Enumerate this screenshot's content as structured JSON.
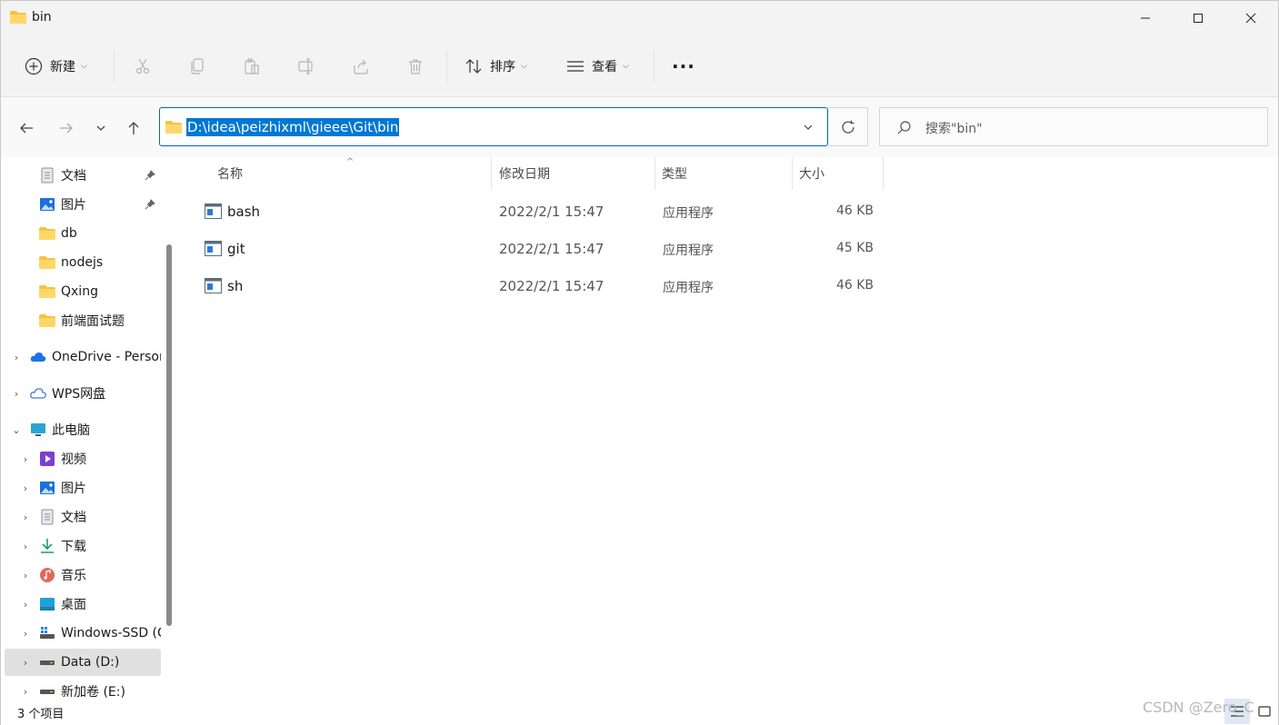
{
  "window": {
    "title": "bin"
  },
  "toolbar": {
    "new_label": "新建",
    "sort_label": "排序",
    "view_label": "查看",
    "more_label": "···"
  },
  "address": {
    "path": "D:\\idea\\peizhixml\\gieee\\Git\\bin",
    "search_placeholder": "搜索\"bin\""
  },
  "sidebar": {
    "quick_items": [
      {
        "label": "文档",
        "icon": "document-icon",
        "pinned": true
      },
      {
        "label": "图片",
        "icon": "pictures-icon",
        "pinned": true
      },
      {
        "label": "db",
        "icon": "folder-icon"
      },
      {
        "label": "nodejs",
        "icon": "folder-icon"
      },
      {
        "label": "Qxing",
        "icon": "folder-icon"
      },
      {
        "label": "前端面试题",
        "icon": "folder-icon"
      }
    ],
    "onedrive": "OneDrive - Personal",
    "wps": "WPS网盘",
    "thispc": "此电脑",
    "pc_items": [
      {
        "label": "视频",
        "icon": "videos-icon"
      },
      {
        "label": "图片",
        "icon": "pictures-icon"
      },
      {
        "label": "文档",
        "icon": "document-icon"
      },
      {
        "label": "下载",
        "icon": "download-icon"
      },
      {
        "label": "音乐",
        "icon": "music-icon"
      },
      {
        "label": "桌面",
        "icon": "desktop-icon"
      },
      {
        "label": "Windows-SSD (C:)",
        "icon": "windows-drive-icon"
      },
      {
        "label": "Data (D:)",
        "icon": "drive-icon",
        "selected": true
      },
      {
        "label": "新加卷 (E:)",
        "icon": "drive-icon"
      }
    ]
  },
  "columns": {
    "name": "名称",
    "modified": "修改日期",
    "type": "类型",
    "size": "大小"
  },
  "files": [
    {
      "name": "bash",
      "modified": "2022/2/1 15:47",
      "type": "应用程序",
      "size": "46 KB"
    },
    {
      "name": "git",
      "modified": "2022/2/1 15:47",
      "type": "应用程序",
      "size": "45 KB"
    },
    {
      "name": "sh",
      "modified": "2022/2/1 15:47",
      "type": "应用程序",
      "size": "46 KB"
    }
  ],
  "status": {
    "count": "3 个项目"
  },
  "watermark": "CSDN @Zero_C",
  "colors": {
    "accent": "#0078d4",
    "folder": "#f6c343"
  }
}
